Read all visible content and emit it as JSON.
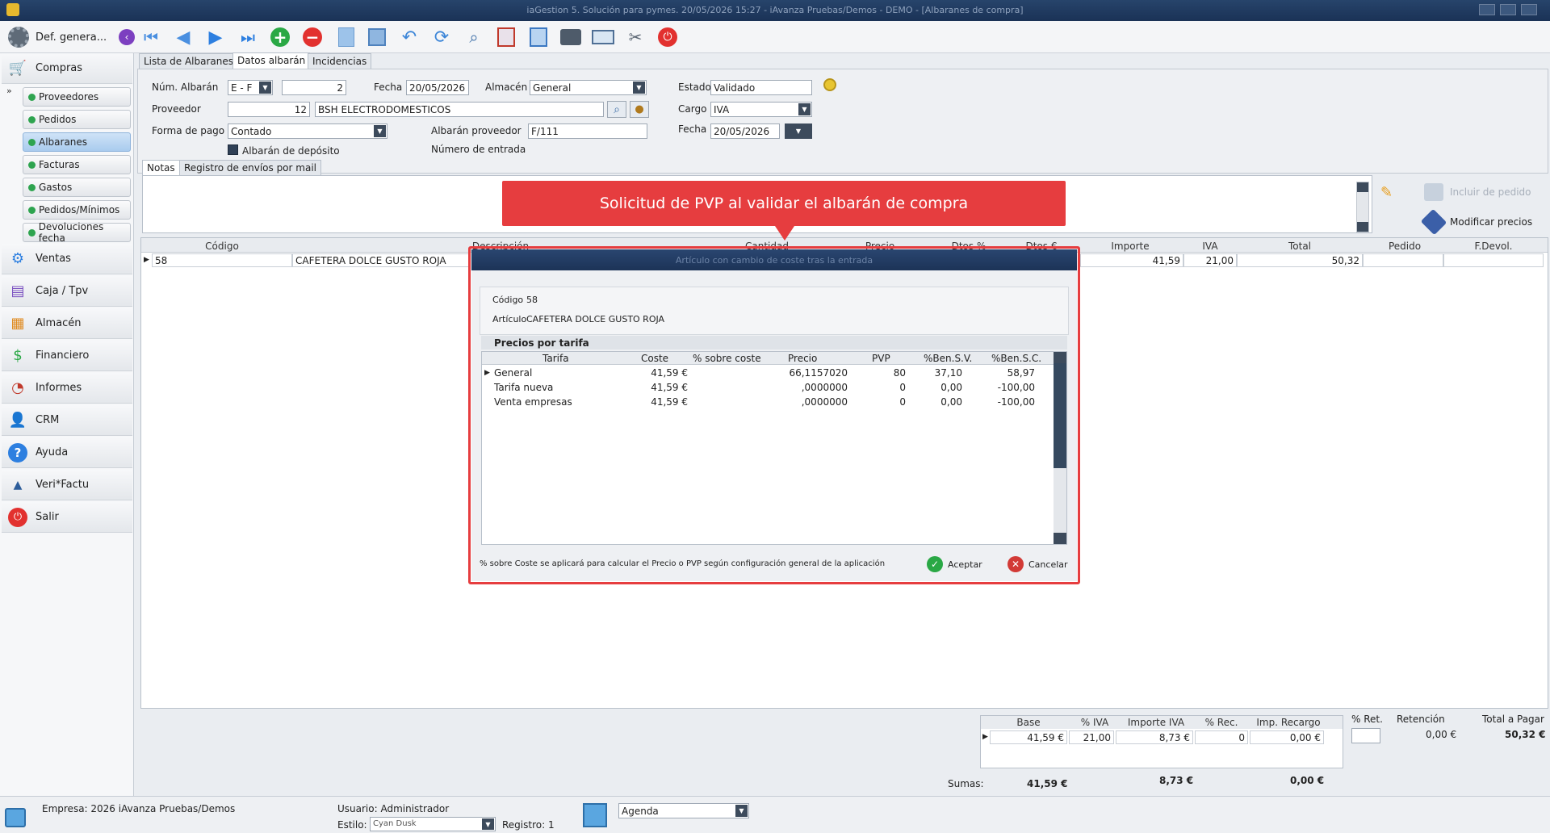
{
  "window": {
    "title": "iaGestion 5. Solución para pymes.  20/05/2026 15:27  -  iAvanza Pruebas/Demos - DEMO - [Albaranes de compra]"
  },
  "sidebar": {
    "top_label": "Def. genera...",
    "compras": "Compras",
    "sub_items": [
      "Proveedores",
      "Pedidos",
      "Albaranes",
      "Facturas",
      "Gastos",
      "Pedidos/Mínimos",
      "Devoluciones fecha"
    ],
    "selected_sub": "Albaranes",
    "items": [
      "Ventas",
      "Caja / Tpv",
      "Almacén",
      "Financiero",
      "Informes",
      "CRM",
      "Ayuda",
      "Veri*Factu",
      "Salir"
    ]
  },
  "tabs": {
    "lista": "Lista de Albaranes",
    "datos": "Datos albarán",
    "incidencias": "Incidencias"
  },
  "form": {
    "num_albaran_label": "Núm. Albarán",
    "serie_value": "E  - F",
    "numero_value": "2",
    "fecha_label": "Fecha",
    "fecha_value": "20/05/2026",
    "almacen_label": "Almacén",
    "almacen_value": "General",
    "estado_label": "Estado",
    "estado_value": "Validado",
    "proveedor_label": "Proveedor",
    "proveedor_code": "12",
    "proveedor_name": "BSH ELECTRODOMESTICOS",
    "cargo_label": "Cargo",
    "cargo_value": "IVA",
    "forma_pago_label": "Forma de pago",
    "forma_pago_value": "Contado",
    "albaran_proveedor_label": "Albarán proveedor",
    "albaran_proveedor_value": "F/111",
    "fecha2_label": "Fecha",
    "fecha2_value": "20/05/2026",
    "deposito_label": "Albarán de depósito",
    "numero_entrada_label": "Número de entrada"
  },
  "subtabs": {
    "notas": "Notas",
    "registro": "Registro de envíos por mail"
  },
  "side_actions": {
    "incluir_pedido": "Incluir de pedido",
    "modificar_precios": "Modificar precios"
  },
  "lines": {
    "headers": [
      "Código",
      "Descripción",
      "Cantidad",
      "Precio",
      "Dtos %",
      "Dtos €",
      "Importe",
      "IVA",
      "Total",
      "Pedido",
      "F.Devol."
    ],
    "rows": [
      {
        "codigo": "58",
        "descripcion": "CAFETERA DOLCE GUSTO ROJA",
        "importe": "41,59",
        "iva": "21,00",
        "total": "50,32"
      }
    ]
  },
  "callout": {
    "text": "Solicitud de PVP al validar el albarán de compra"
  },
  "dialog": {
    "title": "Artículo con cambio de coste tras la entrada",
    "codigo_label": "Código",
    "codigo_value": "58",
    "articulo_label": "Artículo",
    "articulo_value": "CAFETERA DOLCE GUSTO ROJA",
    "section_title": "Precios por tarifa",
    "headers": [
      "Tarifa",
      "Coste",
      "% sobre coste",
      "Precio",
      "PVP",
      "%Ben.S.V.",
      "%Ben.S.C."
    ],
    "rows": [
      {
        "tarifa": "General",
        "coste": "41,59 €",
        "sobre_coste": "",
        "precio": "66,1157020",
        "pvp": "80",
        "ben_sv": "37,10",
        "ben_sc": "58,97"
      },
      {
        "tarifa": "Tarifa nueva",
        "coste": "41,59 €",
        "sobre_coste": "",
        "precio": ",0000000",
        "pvp": "0",
        "ben_sv": "0,00",
        "ben_sc": "-100,00"
      },
      {
        "tarifa": "Venta empresas",
        "coste": "41,59 €",
        "sobre_coste": "",
        "precio": ",0000000",
        "pvp": "0",
        "ben_sv": "0,00",
        "ben_sc": "-100,00"
      }
    ],
    "footer_note": "% sobre Coste se aplicará para calcular el Precio o PVP según configuración general de la aplicación",
    "accept_label": "Aceptar",
    "cancel_label": "Cancelar"
  },
  "totals": {
    "headers": [
      "Base",
      "% IVA",
      "Importe IVA",
      "% Rec.",
      "Imp. Recargo"
    ],
    "row": {
      "base": "41,59 €",
      "iva_pct": "21,00",
      "importe_iva": "8,73 €",
      "rec_pct": "0",
      "imp_recargo": "0,00 €"
    },
    "ret_label": "% Ret.",
    "retencion_label": "Retención",
    "retencion_value": "0,00 €",
    "total_pagar_label": "Total a Pagar",
    "total_pagar_value": "50,32 €",
    "sumas_label": "Sumas:",
    "sumas_base": "41,59 €",
    "sumas_iva": "8,73 €",
    "sumas_recargo": "0,00 €"
  },
  "statusbar": {
    "empresa": "Empresa:  2026 iAvanza Pruebas/Demos",
    "usuario": "Usuario: Administrador",
    "estilo_label": "Estilo:",
    "estilo_value": "Cyan Dusk",
    "registro": "Registro:  1",
    "agenda_value": "Agenda"
  }
}
